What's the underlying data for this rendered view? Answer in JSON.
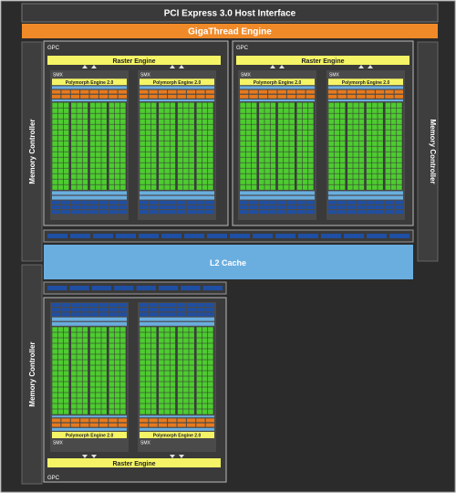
{
  "title": "PCI Express 3.0 Host Interface",
  "gigathread": "GigaThread Engine",
  "memory_controller": "Memory Controller",
  "l2_cache": "L2 Cache",
  "gpc_label": "GPC",
  "raster_engine": "Raster Engine",
  "smx_label": "SMX",
  "polymorph": "Polymorph Engine 2.0",
  "colors": {
    "background": "#2b2b2b",
    "host_bar": "#3a3a3a",
    "gigathread": "#f08a28",
    "raster": "#f4f466",
    "polymorph": "#f4f466",
    "core_green": "#4dcc2f",
    "sm_orange": "#e77a1e",
    "cache_blue": "#6aaee0",
    "reg_blue": "#1f4fa3",
    "mem_ctrl": "#3e3e3e"
  }
}
